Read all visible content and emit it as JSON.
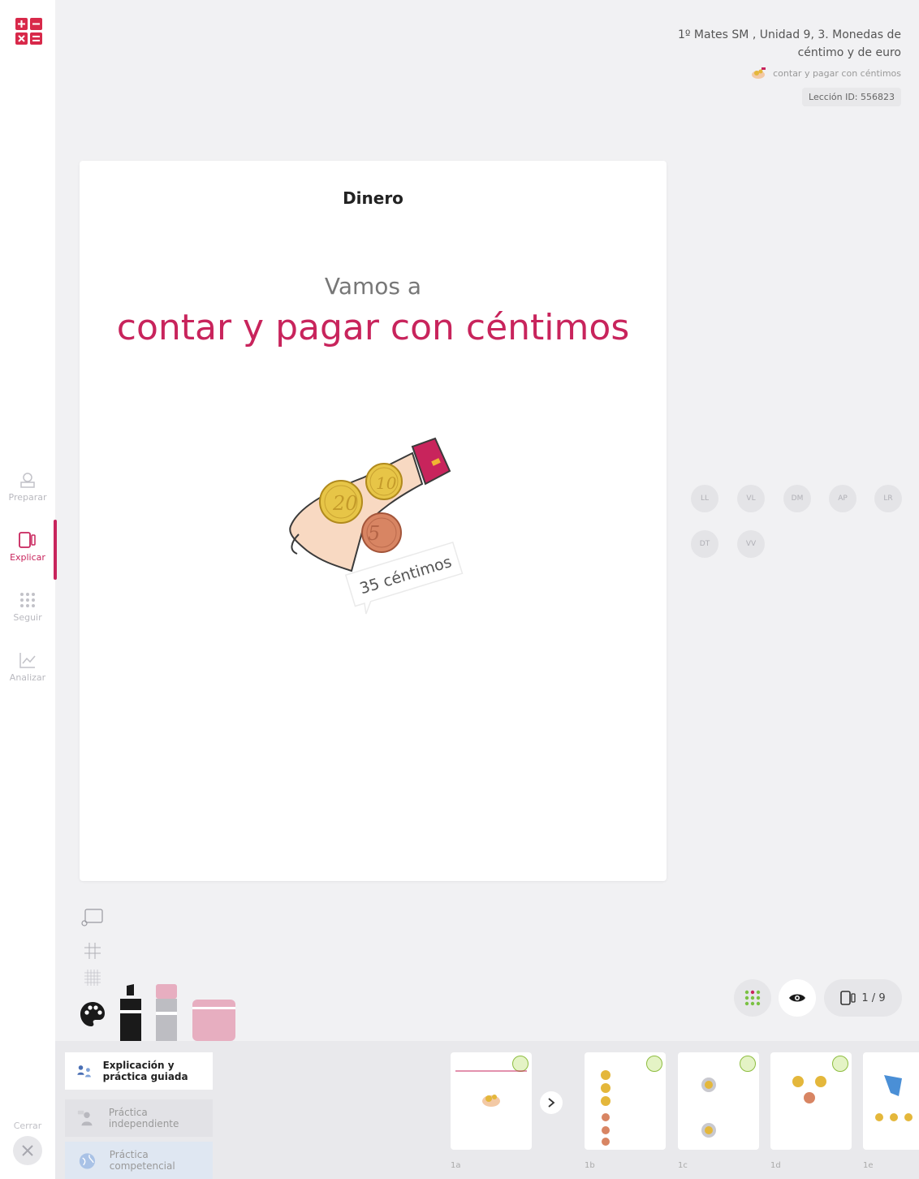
{
  "sidebar": {
    "nav": [
      {
        "label": "Preparar",
        "icon": "prepare-icon"
      },
      {
        "label": "Explicar",
        "icon": "explain-icon"
      },
      {
        "label": "Seguir",
        "icon": "follow-grid-icon"
      },
      {
        "label": "Analizar",
        "icon": "analyze-chart-icon"
      }
    ],
    "close_label": "Cerrar"
  },
  "header": {
    "course": "1º Mates SM , Unidad 9, 3. Monedas de céntimo y de euro",
    "lesson": "contar y pagar con céntimos",
    "lesson_id": "Lección ID: 556823"
  },
  "slide": {
    "title": "Dinero",
    "subtitle": "Vamos a",
    "main": "contar y pagar con céntimos",
    "coin_labels": [
      "20",
      "10",
      "5"
    ],
    "bubble": "35 céntimos"
  },
  "students": [
    "LL",
    "VL",
    "DM",
    "AP",
    "LR",
    "DT",
    "VV"
  ],
  "controls": {
    "page_counter": "1 / 9"
  },
  "phases": [
    {
      "label": "Explicación y práctica guiada"
    },
    {
      "label": "Práctica independiente"
    },
    {
      "label": "Práctica competencial"
    }
  ],
  "thumbnails": [
    {
      "label": "1a"
    },
    {
      "label": "1b"
    },
    {
      "label": "1c"
    },
    {
      "label": "1d"
    },
    {
      "label": "1e"
    }
  ],
  "colors": {
    "accent": "#c8245c",
    "background": "#f1f1f3"
  }
}
